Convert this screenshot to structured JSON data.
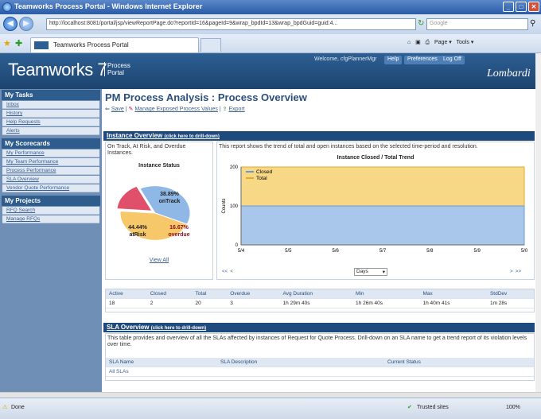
{
  "browser": {
    "title": "Teamworks Process Portal - Windows Internet Explorer",
    "url": "http://localhost:8081/portal/jsp/viewReportPage.do?reportId=16&pageId=9&wrap_bpdId=13&wrap_bpdGuid=guid:4...",
    "search_placeholder": "Google",
    "tab_label": "Teamworks Process Portal",
    "cmd_page": "Page",
    "cmd_tools": "Tools"
  },
  "header": {
    "logo": "Teamworks 7",
    "portal_line1": "Process",
    "portal_line2": "Portal",
    "welcome": "Welcome, cfgPlannerMgr",
    "links": [
      "Help",
      "Preferences",
      "Log Off"
    ],
    "brand": "Lombardi"
  },
  "sidebar": {
    "tasks_head": "My Tasks",
    "tasks": [
      "Inbox",
      "History",
      "Help Requests",
      "Alerts"
    ],
    "scorecards_head": "My Scorecards",
    "scorecards": [
      "My Performance",
      "My Team Performance",
      "Process Performance",
      "SLA Overview",
      "Vendor Quote Performance"
    ],
    "projects_head": "My Projects",
    "projects": [
      "RFQ Search",
      "Manage RFQs"
    ]
  },
  "main": {
    "title": "PM Process Analysis : Process Overview",
    "actions": [
      "Save",
      "Manage Exposed Process Values",
      "Export"
    ],
    "instance_head": "Instance Overview",
    "drill_hint": "(click here to drill-down)",
    "left_desc": "On Track, At Risk, and Overdue Instances.",
    "right_desc": "This report shows the trend of total and open instances based on the selected time-period and resolution.",
    "pie_title": "Instance Status",
    "view_all": "View All",
    "line_title": "Instance Closed / Total Trend",
    "period_select": "Days",
    "stats_headers": [
      "Active",
      "Closed",
      "Total",
      "Overdue",
      "Avg Duration",
      "Min",
      "Max",
      "StdDev"
    ],
    "stats_values": [
      "18",
      "2",
      "20",
      "3",
      "1h 29m 40s",
      "1h 26m 40s",
      "1h 40m 41s",
      "1m 28s"
    ],
    "sla_head": "SLA Overview",
    "sla_desc": "This table provides and overview of all the SLAs affected by instances of Request for Quote Process. Drill-down on an SLA name to get a trend report of its violation levels over time.",
    "sla_headers": [
      "SLA Name",
      "SLA Description",
      "Current Status"
    ],
    "sla_all": "All SLAs"
  },
  "chart_data": [
    {
      "type": "pie",
      "title": "Instance Status",
      "categories": [
        "onTrack",
        "atRisk",
        "overdue"
      ],
      "values": [
        38.89,
        44.44,
        16.67
      ],
      "labels": [
        "38.89%",
        "44.44%",
        "16.67%"
      ],
      "colors": [
        "#8fb8e6",
        "#f7c86a",
        "#e0506a"
      ]
    },
    {
      "type": "area",
      "title": "Instance Closed / Total Trend",
      "x": [
        "5/4",
        "5/5",
        "5/6",
        "5/7",
        "5/8",
        "5/9",
        "5/0"
      ],
      "ylabel": "Counts",
      "yticks": [
        "0",
        "100",
        "200"
      ],
      "ylim": [
        0,
        200
      ],
      "series": [
        {
          "name": "Closed",
          "values": [
            100,
            100,
            100,
            100,
            100,
            100,
            100
          ],
          "color": "#a9c7ea"
        },
        {
          "name": "Total",
          "values": [
            200,
            200,
            200,
            200,
            200,
            200,
            200
          ],
          "color": "#f7d886"
        }
      ],
      "legend": "top-left"
    }
  ],
  "status": {
    "left": "Done",
    "zone": "Trusted sites",
    "zoom": "100%"
  }
}
